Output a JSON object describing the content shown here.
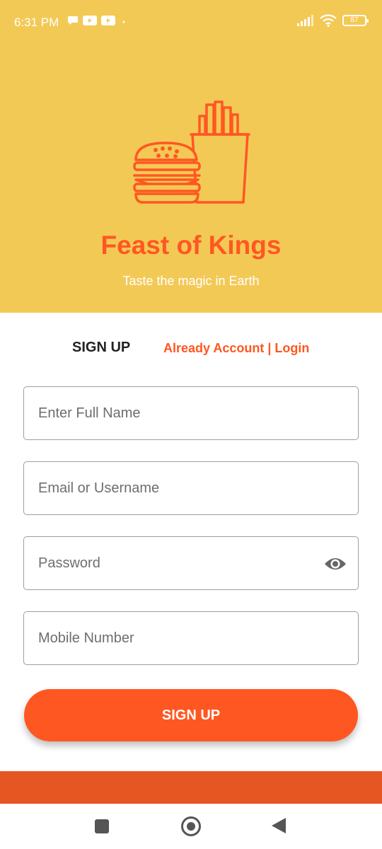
{
  "status_bar": {
    "time": "6:31 PM",
    "battery": "87",
    "icons_left": [
      "chat-icon",
      "youtube-icon",
      "youtube-icon",
      "dot-icon"
    ],
    "icons_right": [
      "signal-icon",
      "wifi-icon",
      "battery-icon"
    ]
  },
  "brand": {
    "title": "Feast of Kings",
    "tagline": "Taste the magic in Earth",
    "logo_icon": "burger-fries-icon",
    "accent_color": "#FF5722",
    "header_color": "#F3C956"
  },
  "tabs": {
    "signup_label": "SIGN UP",
    "login_label": "Already Account | Login"
  },
  "form": {
    "full_name": {
      "placeholder": "Enter Full Name",
      "value": ""
    },
    "email": {
      "placeholder": "Email or Username",
      "value": ""
    },
    "password": {
      "placeholder": "Password",
      "value": "",
      "toggle_icon": "eye-icon"
    },
    "mobile": {
      "placeholder": "Mobile Number",
      "value": ""
    },
    "submit_label": "SIGN UP"
  },
  "nav": {
    "recent_icon": "square-icon",
    "home_icon": "circle-icon",
    "back_icon": "triangle-back-icon"
  }
}
